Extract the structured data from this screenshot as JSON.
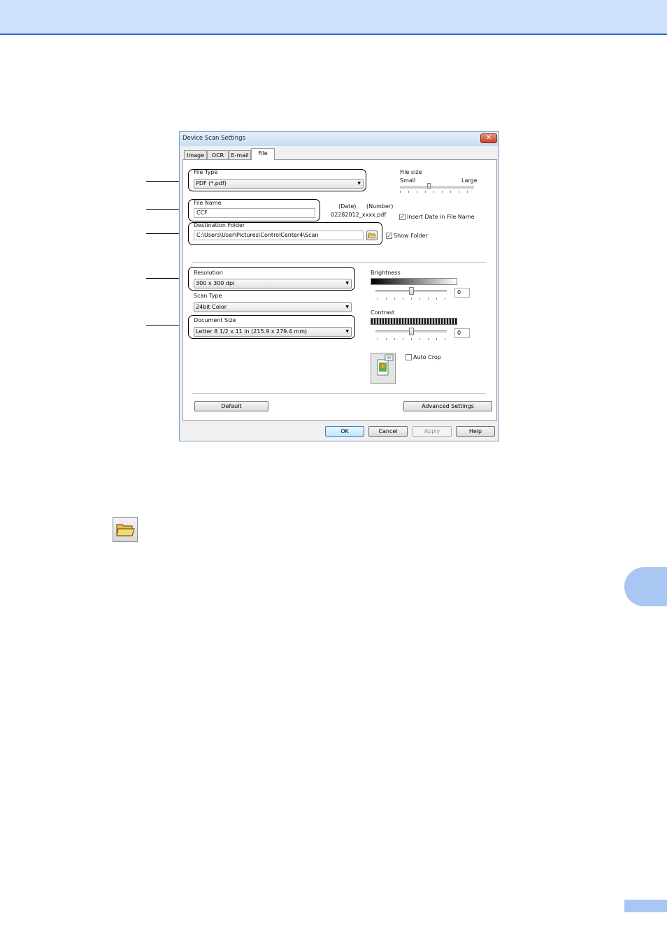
{
  "dialog": {
    "title": "Device Scan Settings",
    "close_glyph": "✕",
    "tabs": [
      {
        "label": "Image",
        "active": false
      },
      {
        "label": "OCR",
        "active": false
      },
      {
        "label": "E-mail",
        "active": false
      },
      {
        "label": "File",
        "active": true
      }
    ],
    "file_type": {
      "label": "File Type",
      "value": "PDF (*.pdf)"
    },
    "file_size": {
      "label": "File size",
      "min_label": "Small",
      "max_label": "Large",
      "level": 0.4
    },
    "file_name": {
      "label": "File Name",
      "value": "CCF",
      "date_header": "(Date)",
      "number_header": "(Number)",
      "example": "02282012_xxxx.pdf",
      "insert_date_label": "Insert Date in File Name",
      "insert_date_checked": true
    },
    "destination": {
      "label": "Destination Folder",
      "value": "C:\\Users\\User\\Pictures\\ControlCenter4\\Scan",
      "show_folder_label": "Show Folder",
      "show_folder_checked": true
    },
    "resolution": {
      "label": "Resolution",
      "value": "300 x 300 dpi"
    },
    "scan_type": {
      "label": "Scan Type",
      "value": "24bit Color"
    },
    "document_size": {
      "label": "Document Size",
      "value": "Letter 8 1/2 x 11 in (215.9 x 279.4 mm)"
    },
    "brightness": {
      "label": "Brightness",
      "value": "0",
      "level": 0.5
    },
    "contrast": {
      "label": "Contrast",
      "value": "0",
      "level": 0.5
    },
    "auto_crop": {
      "label": "Auto Crop",
      "checked": false
    },
    "buttons": {
      "default": "Default",
      "advanced": "Advanced Settings",
      "ok": "OK",
      "cancel": "Cancel",
      "apply": "Apply",
      "help": "Help"
    },
    "checkmark": "✓",
    "dropdown_arrow": "▼"
  },
  "icons": {
    "folder_button_icon": "folder-open-icon",
    "crop_preview_icon": "document-image-icon"
  },
  "colors": {
    "header_band": "#cfe0fb",
    "header_rule": "#2a6cc8",
    "chapter_tab": "#a8c7f2"
  }
}
